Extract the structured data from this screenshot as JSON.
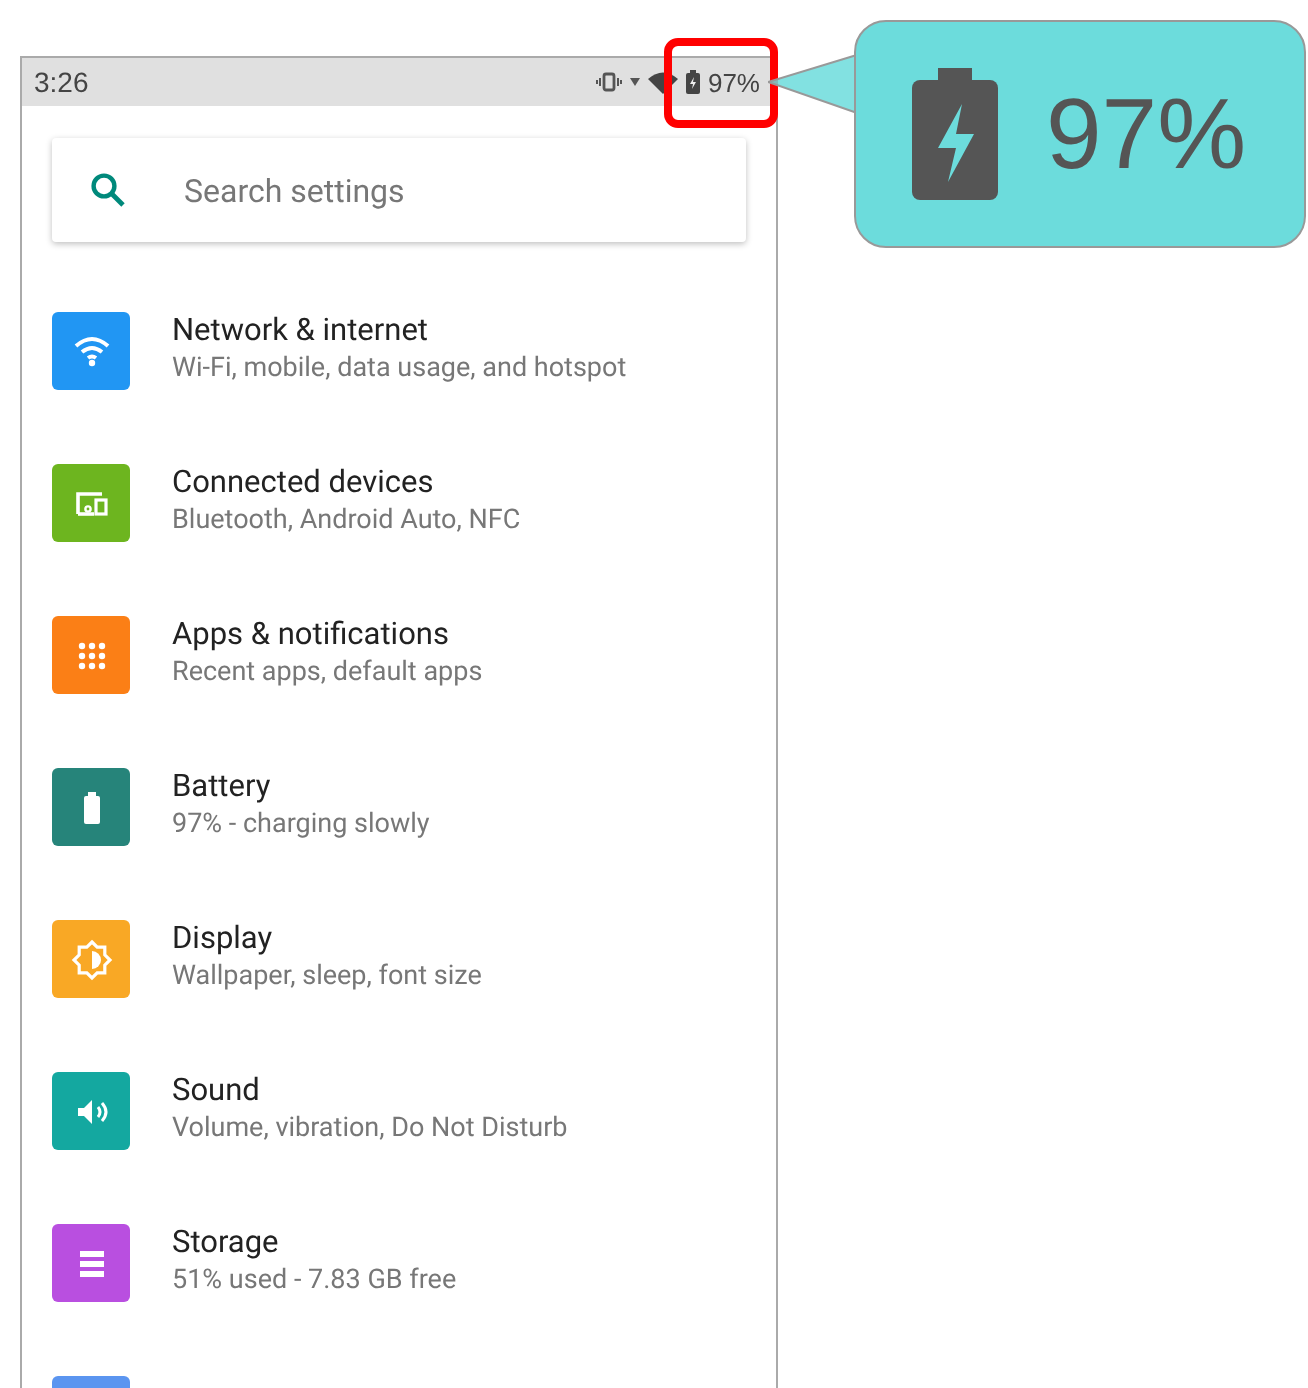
{
  "status_bar": {
    "time": "3:26",
    "battery": "97%"
  },
  "search": {
    "placeholder": "Search settings"
  },
  "items": [
    {
      "title": "Network & internet",
      "subtitle": "Wi-Fi, mobile, data usage, and hotspot",
      "color": "#2196f3"
    },
    {
      "title": "Connected devices",
      "subtitle": "Bluetooth, Android Auto, NFC",
      "color": "#6db51f"
    },
    {
      "title": "Apps & notifications",
      "subtitle": "Recent apps, default apps",
      "color": "#fb7f16"
    },
    {
      "title": "Battery",
      "subtitle": "97% - charging slowly",
      "color": "#26847a"
    },
    {
      "title": "Display",
      "subtitle": "Wallpaper, sleep, font size",
      "color": "#f9a825"
    },
    {
      "title": "Sound",
      "subtitle": "Volume, vibration, Do Not Disturb",
      "color": "#14a8a0"
    },
    {
      "title": "Storage",
      "subtitle": "51% used - 7.83 GB free",
      "color": "#b94fe0"
    },
    {
      "color": "#5b95f0"
    }
  ],
  "callout": {
    "text": "97%"
  }
}
